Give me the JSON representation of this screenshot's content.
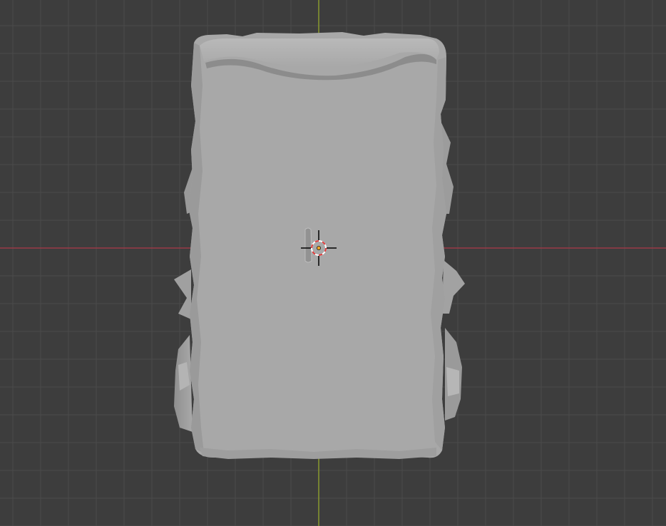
{
  "viewport": {
    "background_color": "#3d3d3d",
    "grid_minor_color": "#4a4a4a",
    "grid_major_color": "#545454",
    "x_axis_color": "#9a3a46",
    "y_axis_color": "#8a9a2e",
    "model_color": "#a9a9a9",
    "model_shadow_color": "#8a8a8a",
    "model_highlight_color": "#c0c0c0"
  },
  "overlays": {
    "cursor_3d": {
      "icon": "3d-cursor-icon",
      "ring_colors": [
        "#ffffff",
        "#e03a3a"
      ],
      "crosshair_color": "#000000"
    },
    "origin": {
      "icon": "object-origin-icon",
      "color": "#f5a623"
    }
  },
  "object": {
    "name_shown": ""
  }
}
